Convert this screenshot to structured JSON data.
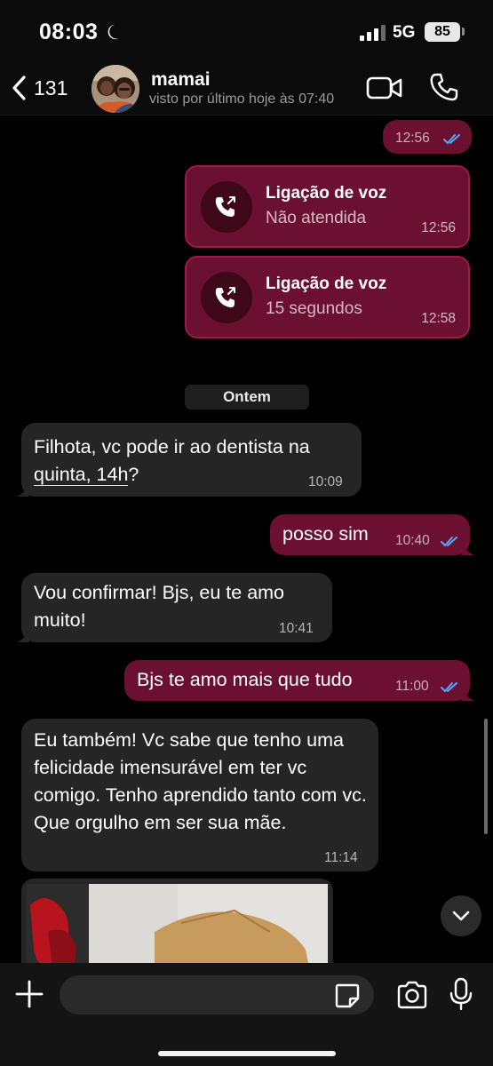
{
  "status_bar": {
    "time": "08:03",
    "network": "5G",
    "battery": "85"
  },
  "header": {
    "back_count": "131",
    "contact_name": "mamai",
    "contact_status": "visto por último hoje às 07:40"
  },
  "messages": {
    "m0": {
      "time": "12:56"
    },
    "call1": {
      "title": "Ligação de voz",
      "subtitle": "Não atendida",
      "time": "12:56"
    },
    "call2": {
      "title": "Ligação de voz",
      "subtitle": "15 segundos",
      "time": "12:58"
    },
    "date_divider": "Ontem",
    "m1": {
      "line1": "Filhota, vc pode ir ao dentista na",
      "line2_link": "quinta, 14h",
      "line2_rest": "?",
      "time": "10:09"
    },
    "m2": {
      "text": "posso sim",
      "time": "10:40"
    },
    "m3": {
      "text": "Vou confirmar! Bjs, eu te amo muito!",
      "time": "10:41"
    },
    "m4": {
      "text": "Bjs te amo mais que tudo",
      "time": "11:00"
    },
    "m5": {
      "text": "Eu também! Vc sabe que tenho uma felicidade imensurável em ter vc comigo. Tenho aprendido tanto com vc. Que orgulho em ser sua mãe.",
      "time": "11:14"
    }
  },
  "input": {
    "placeholder": ""
  },
  "icons": {
    "back": "chevron-left-icon",
    "video": "video-camera-icon",
    "call": "phone-icon",
    "plus": "plus-icon",
    "sticker": "sticker-icon",
    "camera": "camera-icon",
    "mic": "microphone-icon",
    "scroll": "chevron-down-icon",
    "read": "double-check-icon",
    "dnd": "moon-icon"
  },
  "colors": {
    "outgoing_bubble": "#6b1030",
    "incoming_bubble": "#252525",
    "read_ticks": "#53a6ff",
    "background": "#000000"
  }
}
